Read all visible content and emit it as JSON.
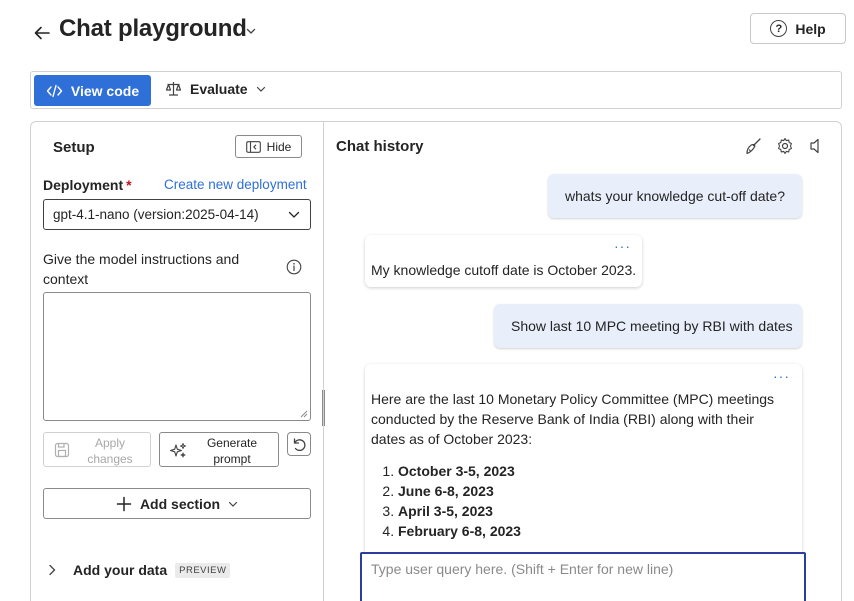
{
  "header": {
    "title": "Chat playground",
    "help_label": "Help",
    "help_glyph": "?"
  },
  "toolbar": {
    "view_code_label": "View code",
    "evaluate_label": "Evaluate"
  },
  "setup": {
    "title": "Setup",
    "hide_label": "Hide",
    "deployment_label": "Deployment",
    "required_mark": "*",
    "create_link": "Create new deployment",
    "deployment_value": "gpt-4.1-nano (version:2025-04-14)",
    "instructions_label": "Give the model instructions and context",
    "instructions_value": "",
    "apply_label": "Apply changes",
    "generate_label": "Generate prompt",
    "add_section_label": "Add section",
    "add_data_label": "Add your data",
    "preview_badge": "PREVIEW"
  },
  "chat": {
    "title": "Chat history",
    "more_glyph": "···",
    "messages": [
      {
        "role": "user",
        "text": "whats your knowledge cut-off date?"
      },
      {
        "role": "assistant",
        "text": "My knowledge cutoff date is October 2023."
      },
      {
        "role": "user",
        "text": "Show last 10 MPC meeting by RBI with dates"
      },
      {
        "role": "assistant",
        "text": "Here are the last 10 Monetary Policy Committee (MPC) meetings conducted by the Reserve Bank of India (RBI) along with their dates as of October 2023:",
        "list": [
          "October 3-5, 2023",
          "June 6-8, 2023",
          "April 3-5, 2023",
          "February 6-8, 2023"
        ]
      }
    ],
    "input_placeholder": "Type user query here. (Shift + Enter for new line)"
  },
  "colors": {
    "accent": "#2f6fd8",
    "user_bubble": "#e8effa",
    "required": "#c50f1f",
    "input_focus": "#2b3d9e"
  },
  "icons": [
    "back-arrow-icon",
    "chevron-down-icon",
    "help-icon",
    "code-icon",
    "scale-icon",
    "hide-panel-icon",
    "info-icon",
    "save-icon",
    "sparkle-icon",
    "undo-icon",
    "plus-icon",
    "chevron-right-icon",
    "broom-icon",
    "gear-icon",
    "speaker-icon"
  ]
}
